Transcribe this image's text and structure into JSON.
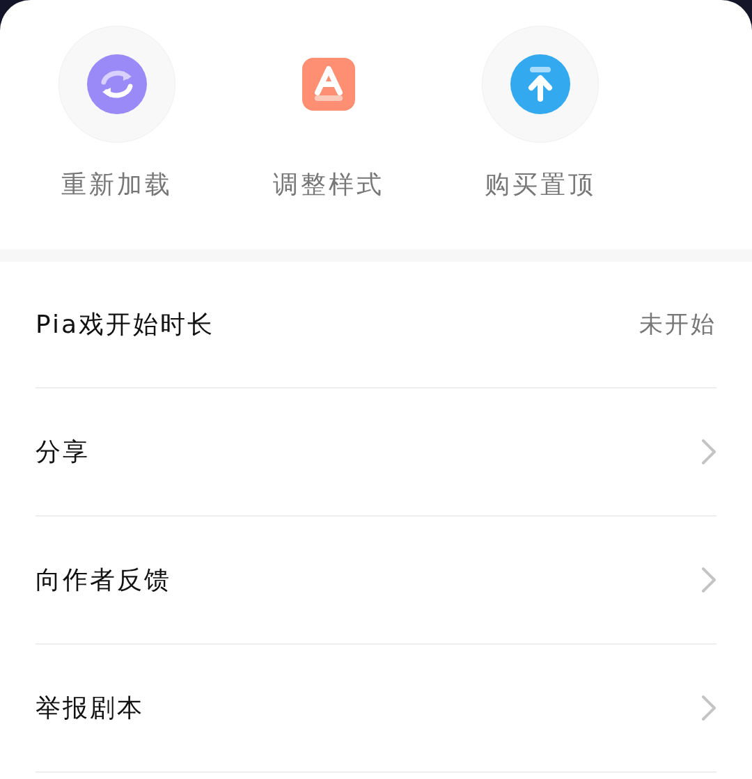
{
  "actions": [
    {
      "kind": "reload",
      "label": "重新加载",
      "backdrop": true
    },
    {
      "kind": "style",
      "label": "调整样式",
      "backdrop": false
    },
    {
      "kind": "pin",
      "label": "购买置顶",
      "backdrop": true
    }
  ],
  "rows": [
    {
      "kind": "value",
      "label": "Pia戏开始时长",
      "value": "未开始"
    },
    {
      "kind": "link",
      "label": "分享"
    },
    {
      "kind": "link",
      "label": "向作者反馈"
    },
    {
      "kind": "link",
      "label": "举报剧本"
    }
  ]
}
